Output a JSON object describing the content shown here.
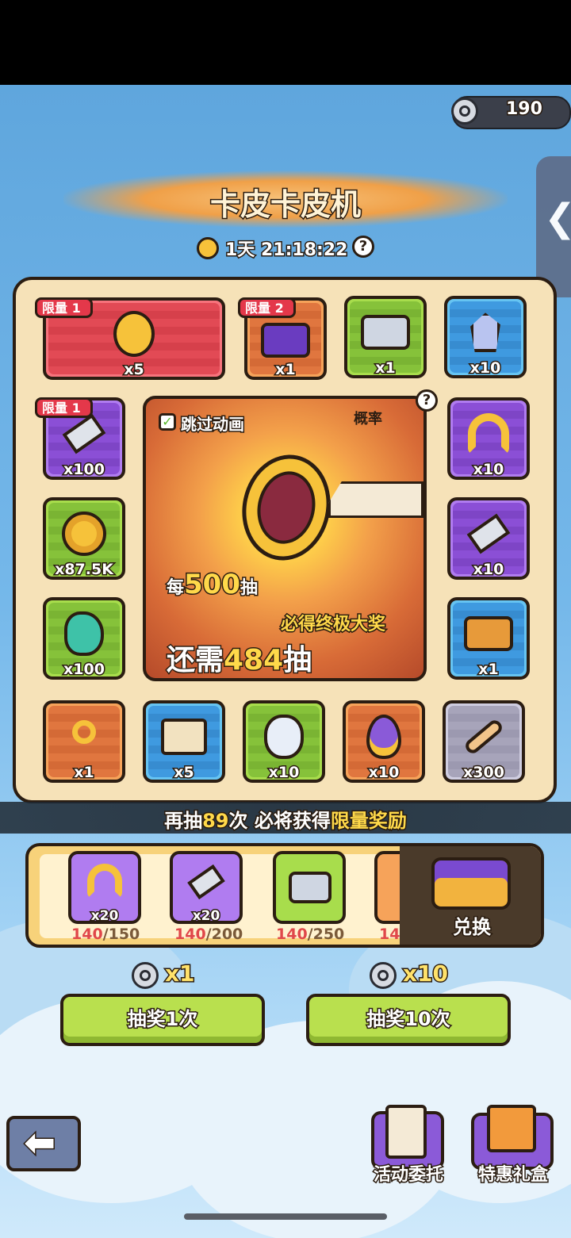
{
  "currency": {
    "amount": "190"
  },
  "title": "卡皮卡皮机",
  "timer": "1天 21:18:22",
  "grid": {
    "top_row": [
      {
        "badge": "限量 1",
        "qty": "x5",
        "color": "red",
        "icon": "capybara-coin-icon"
      },
      {
        "badge": "限量 2",
        "qty": "x1",
        "color": "orange",
        "icon": "purple-chest-icon"
      },
      {
        "badge": "",
        "qty": "x1",
        "color": "green",
        "icon": "silver-chest-icon"
      },
      {
        "badge": "",
        "qty": "x10",
        "color": "blue",
        "icon": "crystal-icon"
      }
    ],
    "left_col": [
      {
        "badge": "限量 1",
        "qty": "x100",
        "color": "purple",
        "icon": "hammer-icon"
      },
      {
        "badge": "",
        "qty": "x87.5K",
        "color": "green",
        "icon": "gold-coin-icon"
      },
      {
        "badge": "",
        "qty": "x100",
        "color": "green",
        "icon": "rune-stone-icon"
      }
    ],
    "right_col": [
      {
        "badge": "",
        "qty": "x10",
        "color": "purple",
        "icon": "horseshoe-icon"
      },
      {
        "badge": "",
        "qty": "x10",
        "color": "purple",
        "icon": "hammer-icon"
      },
      {
        "badge": "",
        "qty": "x1",
        "color": "blue",
        "icon": "gold-chest-icon"
      }
    ],
    "bottom_row": [
      {
        "badge": "",
        "qty": "x1",
        "color": "orange",
        "icon": "key-icon"
      },
      {
        "badge": "",
        "qty": "x5",
        "color": "blue",
        "icon": "scroll-icon"
      },
      {
        "badge": "",
        "qty": "x10",
        "color": "green",
        "icon": "spiral-stone-icon"
      },
      {
        "badge": "",
        "qty": "x10",
        "color": "orange",
        "icon": "egg-icon"
      },
      {
        "badge": "",
        "qty": "x300",
        "color": "gray",
        "icon": "bone-icon"
      }
    ]
  },
  "jackpot": {
    "skip_label": "跳过动画",
    "prob_label": "概率",
    "every_prefix": "每",
    "every_num": "500",
    "every_suffix": "抽",
    "guarantee": "必得终极大奖",
    "remaining_prefix": "还需",
    "remaining_num": "484",
    "remaining_suffix": "抽"
  },
  "banner": {
    "p1": "再抽",
    "num": "89",
    "p2": "次 必将获得",
    "highlight": "限量奖励"
  },
  "milestones": [
    {
      "qty": "x20",
      "current": "140",
      "target": "/150",
      "color": "purple",
      "icon": "horseshoe-icon"
    },
    {
      "qty": "x20",
      "current": "140",
      "target": "/200",
      "color": "purple",
      "icon": "hammer-icon"
    },
    {
      "qty": "",
      "current": "140",
      "target": "/250",
      "color": "green",
      "icon": "silver-chest-icon"
    },
    {
      "qty": "",
      "current": "14",
      "target": "",
      "color": "orange",
      "icon": "partial-reward-icon"
    }
  ],
  "exchange_label": "兑换",
  "draws": [
    {
      "cost": "x1",
      "label": "抽奖1次"
    },
    {
      "cost": "x10",
      "label": "抽奖10次"
    }
  ],
  "bottom_nav": {
    "tasks": "活动委托",
    "gift": "特惠礼盒"
  }
}
